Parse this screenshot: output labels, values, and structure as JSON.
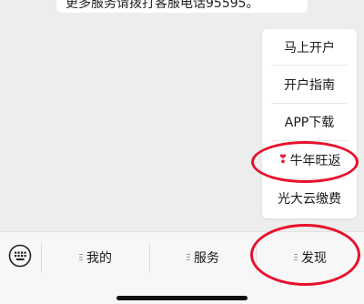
{
  "chat": {
    "message_text": "更多服务请拨打客服电话95595。"
  },
  "menu": {
    "items": [
      {
        "label": "马上开户"
      },
      {
        "label": "开户指南"
      },
      {
        "label": "APP下载"
      },
      {
        "label": "牛年旺返",
        "icon": "heart-exclamation-icon"
      },
      {
        "label": "光大云缴费"
      }
    ]
  },
  "tabbar": {
    "keyboard_icon": "keyboard-icon",
    "tabs": [
      {
        "label": "我的"
      },
      {
        "label": "服务"
      },
      {
        "label": "发现"
      }
    ]
  },
  "colors": {
    "background": "#ededed",
    "annotation": "#e8112d",
    "heart": "#e0233a"
  }
}
